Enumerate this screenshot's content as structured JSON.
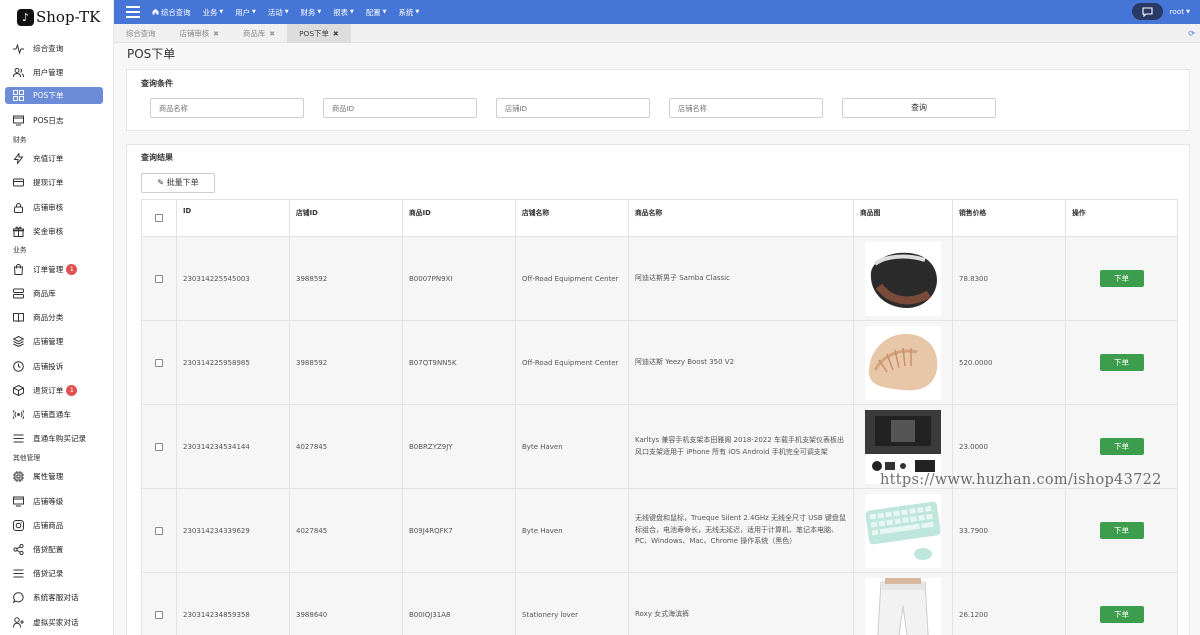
{
  "app": {
    "name": "Shop-TK",
    "logo_glyph": "♪"
  },
  "sidebar": {
    "items": [
      {
        "label": "综合查询",
        "icon": "activity-icon"
      },
      {
        "label": "用户管理",
        "icon": "users-icon"
      },
      {
        "label": "POS下单",
        "icon": "grid-icon",
        "active": true
      },
      {
        "label": "POS日志",
        "icon": "monitor-icon"
      }
    ],
    "section_finance": "财务",
    "finance_items": [
      {
        "label": "充值订单",
        "icon": "bolt-icon"
      },
      {
        "label": "提现订单",
        "icon": "card-icon"
      },
      {
        "label": "店铺审核",
        "icon": "lock-icon"
      },
      {
        "label": "奖金审核",
        "icon": "gift-icon"
      }
    ],
    "section_business": "业务",
    "business_items": [
      {
        "label": "订单管理",
        "icon": "bag-icon",
        "badge": "1"
      },
      {
        "label": "商品库",
        "icon": "server-icon"
      },
      {
        "label": "商品分类",
        "icon": "book-icon"
      },
      {
        "label": "店铺管理",
        "icon": "layers-icon"
      },
      {
        "label": "店铺投诉",
        "icon": "clock-icon"
      },
      {
        "label": "退货订单",
        "icon": "box-icon",
        "badge": "1"
      },
      {
        "label": "店铺直通车",
        "icon": "radio-icon"
      },
      {
        "label": "直通车购买记录",
        "icon": "list-icon"
      }
    ],
    "section_other": "其他管理",
    "other_items": [
      {
        "label": "属性管理",
        "icon": "cpu-icon"
      },
      {
        "label": "店铺等级",
        "icon": "monitor-icon"
      },
      {
        "label": "店铺商品",
        "icon": "instagram-icon"
      },
      {
        "label": "借贷配置",
        "icon": "share-icon"
      },
      {
        "label": "借贷记录",
        "icon": "list-icon"
      },
      {
        "label": "系统客服对话",
        "icon": "message-icon"
      },
      {
        "label": "虚拟买家对话",
        "icon": "user-plus-icon"
      }
    ]
  },
  "topnav": {
    "items": [
      {
        "label": "综合查询",
        "icon": "home-icon"
      },
      {
        "label": "业务",
        "dropdown": true
      },
      {
        "label": "用户",
        "dropdown": true
      },
      {
        "label": "活动",
        "dropdown": true
      },
      {
        "label": "财务",
        "dropdown": true
      },
      {
        "label": "报表",
        "dropdown": true
      },
      {
        "label": "配置",
        "dropdown": true
      },
      {
        "label": "系统",
        "dropdown": true
      }
    ],
    "username": "root"
  },
  "tabs": [
    {
      "label": "综合查询",
      "closable": false
    },
    {
      "label": "店铺审核",
      "closable": true
    },
    {
      "label": "商品库",
      "closable": true
    },
    {
      "label": "POS下单",
      "closable": true,
      "active": true
    }
  ],
  "page": {
    "title": "POS下单"
  },
  "search": {
    "title": "查询条件",
    "fields": [
      {
        "placeholder": "商品名称"
      },
      {
        "placeholder": "商品ID"
      },
      {
        "placeholder": "店铺ID"
      },
      {
        "placeholder": "店铺名称"
      }
    ],
    "button": "查询"
  },
  "results": {
    "title": "查询结果",
    "batch_button": "批量下单",
    "columns": [
      "ID",
      "店铺ID",
      "商品ID",
      "店铺名称",
      "商品名称",
      "商品图",
      "销售价格",
      "操作"
    ],
    "action_label": "下单",
    "rows": [
      {
        "id": "230314225545003",
        "shop_id": "3988592",
        "product_id": "B0007PN9XI",
        "shop_name": "Off-Road Equipment Center",
        "product_name": "阿迪达斯男子 Samba Classic",
        "image": "shoe-dark",
        "price": "78.8300"
      },
      {
        "id": "230314225958985",
        "shop_id": "3988592",
        "product_id": "B07QT9NN5K",
        "shop_name": "Off-Road Equipment Center",
        "product_name": "阿迪达斯 Yeezy Boost 350 V2",
        "image": "shoe-tan",
        "price": "520.0000"
      },
      {
        "id": "230314234534144",
        "shop_id": "4027845",
        "product_id": "B0BRZYZ9JY",
        "shop_name": "Byte Haven",
        "product_name": "Karltys 兼容手机支架本田雅阁 2018-2022 车载手机支架仪表板出风口支架适用于 iPhone 所有 iOS Android 手机完全可调支架",
        "image": "phone-mount",
        "price": "23.0000"
      },
      {
        "id": "230314234339629",
        "shop_id": "4027845",
        "product_id": "B09J4RQFK7",
        "shop_name": "Byte Haven",
        "product_name": "无线键盘和鼠标，Trueque Silent 2.4GHz 无线全尺寸 USB 键盘鼠标组合，电池寿命长，无线无延迟，适用于计算机、笔记本电脑、PC、Windows、Mac、Chrome 操作系统（黑色）",
        "image": "keyboard",
        "price": "33.7900"
      },
      {
        "id": "230314234859358",
        "shop_id": "3988640",
        "product_id": "B00IQJ31A8",
        "shop_name": "Stationery lover",
        "product_name": "Roxy 女式海滨裤",
        "image": "pants",
        "price": "26.1200"
      }
    ]
  },
  "watermark": "https://www.huzhan.com/ishop43722"
}
